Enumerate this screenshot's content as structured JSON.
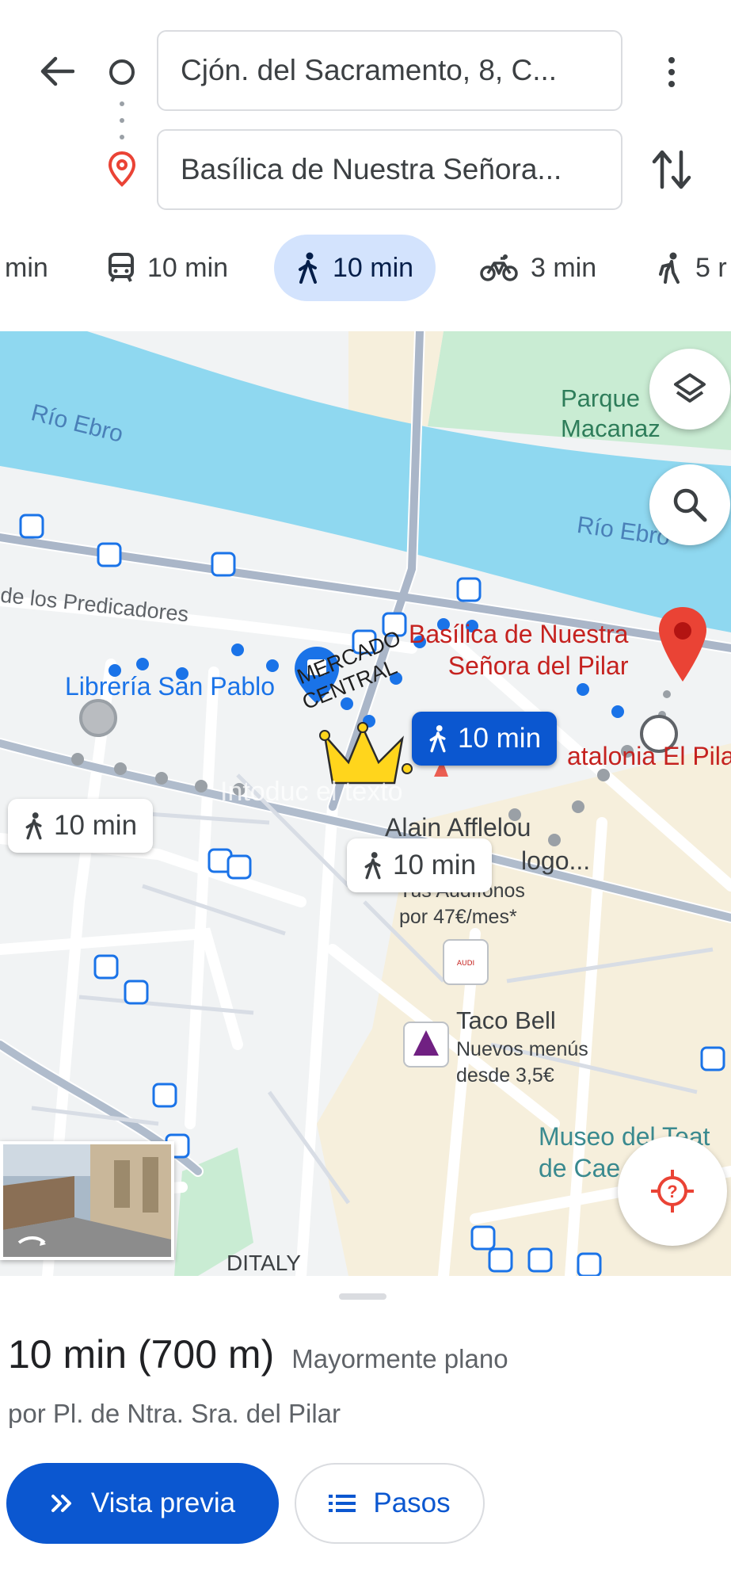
{
  "header": {
    "origin_value": "Cjón. del Sacramento, 8, C...",
    "destination_value": "Basílica de Nuestra Señora..."
  },
  "modes": [
    {
      "icon": "car-icon",
      "label": "min"
    },
    {
      "icon": "transit-icon",
      "label": "10 min"
    },
    {
      "icon": "walk-icon",
      "label": "10 min",
      "selected": true
    },
    {
      "icon": "bike-icon",
      "label": "3 min"
    },
    {
      "icon": "ride-icon",
      "label": "5 r"
    }
  ],
  "map": {
    "labels": {
      "river_left": "Río Ebro",
      "river_right": "Río Ebro",
      "park_line1": "Parque",
      "park_line2": "Macanaz",
      "street_predicadores": "de los Predicadores",
      "libreria": "Librería San Pablo",
      "basilica_line1": "Basílica de Nuestra",
      "basilica_line2": "Señora del Pilar",
      "mercado_line1": "MERCADO",
      "mercado_line2": "CENTRAL",
      "catalonia": "atalonia El Pila",
      "afflelou": "Alain Afflelou",
      "afflelou_sub": "logo...",
      "audifonos_line1": "Tus Audífonos",
      "audifonos_line2": "por 47€/mes*",
      "tacobell": "Taco Bell",
      "tacobell_line1": "Nuevos menús",
      "tacobell_line2": "desde 3,5€",
      "museo_line1": "Museo del Teat",
      "museo_line2": "de Cae",
      "ditaly": "DITALY",
      "watermark": "Intoduc el texto"
    },
    "chips": {
      "selected": "10 min",
      "alt_left": "10 min",
      "alt_bottom": "10 min"
    },
    "colors": {
      "water": "#8fd8f0",
      "park": "#c9ecd3",
      "route": "#1a73e8",
      "route_alt": "#9aa0a6",
      "pin": "#ea4335"
    }
  },
  "sheet": {
    "time": "10 min (700 m)",
    "terrain": "Mayormente plano",
    "via": "por Pl. de Ntra. Sra. del Pilar",
    "preview_label": "Vista previa",
    "steps_label": "Pasos"
  }
}
